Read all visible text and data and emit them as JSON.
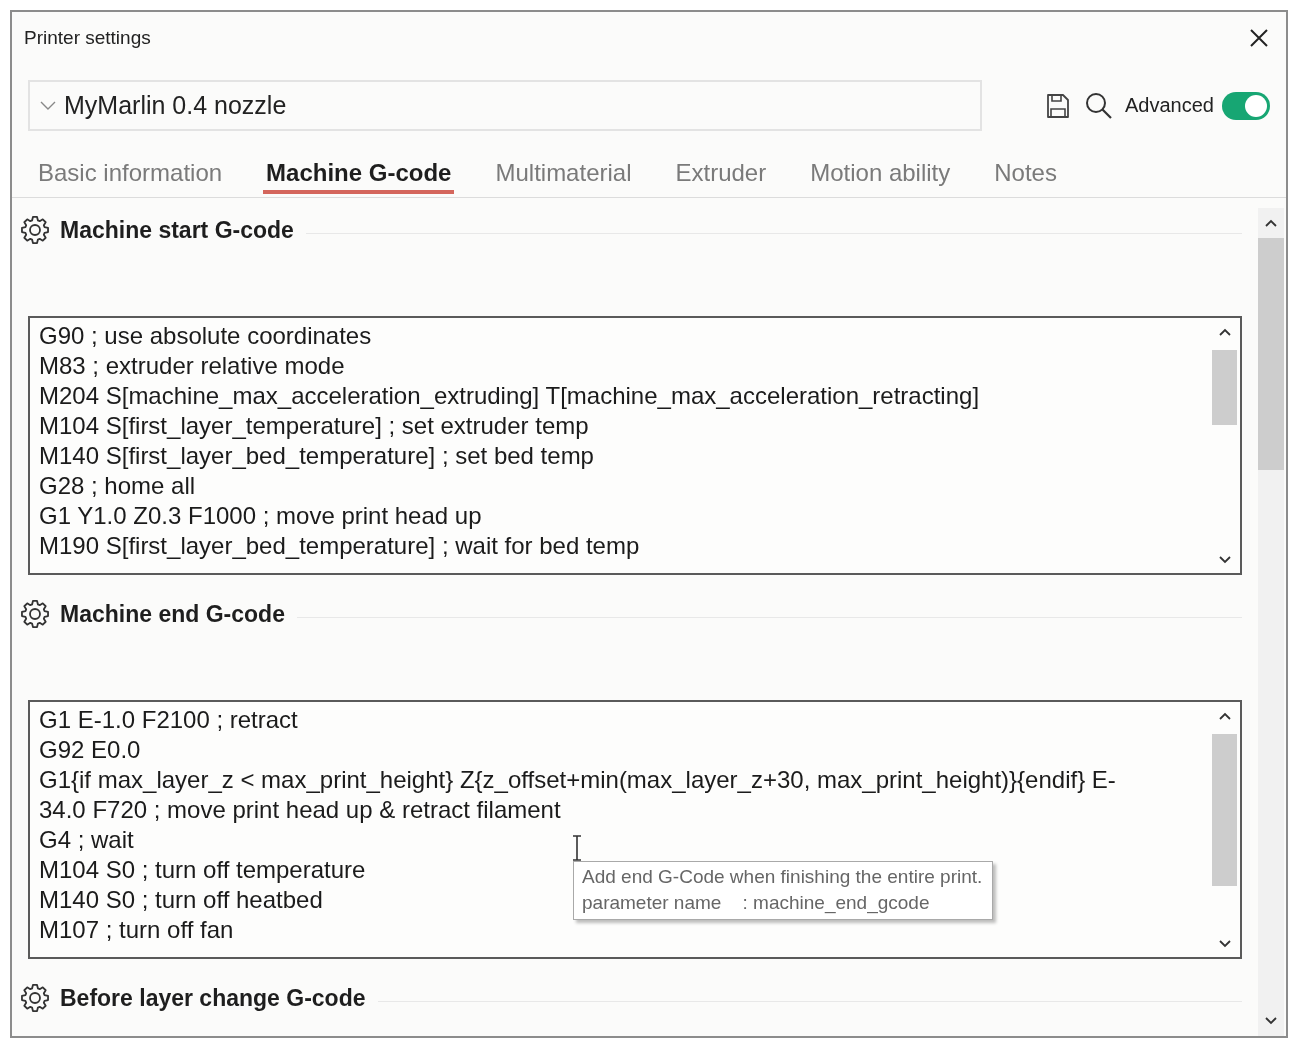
{
  "window": {
    "title": "Printer settings"
  },
  "preset": {
    "value": "MyMarlin 0.4 nozzle"
  },
  "toolbar": {
    "advanced": {
      "label": "Advanced",
      "on": true
    }
  },
  "tabs": [
    {
      "label": "Basic information",
      "selected": false
    },
    {
      "label": "Machine G-code",
      "selected": true
    },
    {
      "label": "Multimaterial",
      "selected": false
    },
    {
      "label": "Extruder",
      "selected": false
    },
    {
      "label": "Motion ability",
      "selected": false
    },
    {
      "label": "Notes",
      "selected": false
    }
  ],
  "sections": [
    {
      "title": "Machine start G-code",
      "lines": [
        "G90 ; use absolute coordinates",
        "M83 ; extruder relative mode",
        "M204 S[machine_max_acceleration_extruding] T[machine_max_acceleration_retracting]",
        "M104 S[first_layer_temperature] ; set extruder temp",
        "M140 S[first_layer_bed_temperature] ; set bed temp",
        "G28 ; home all",
        "G1 Y1.0 Z0.3 F1000 ; move print head up",
        "M190 S[first_layer_bed_temperature] ; wait for bed temp"
      ]
    },
    {
      "title": "Machine end G-code",
      "lines": [
        "G1 E-1.0 F2100 ; retract",
        "G92 E0.0",
        "G1{if max_layer_z < max_print_height} Z{z_offset+min(max_layer_z+30, max_print_height)}{endif} E-",
        "34.0 F720 ; move print head up & retract filament",
        "G4 ; wait",
        "M104 S0 ; turn off temperature",
        "M140 S0 ; turn off heatbed",
        "M107 ; turn off fan"
      ],
      "tooltip": {
        "lines": [
          "Add end G-Code when finishing the entire print.",
          "parameter name    : machine_end_gcode"
        ]
      }
    },
    {
      "title": "Before layer change G-code"
    }
  ]
}
